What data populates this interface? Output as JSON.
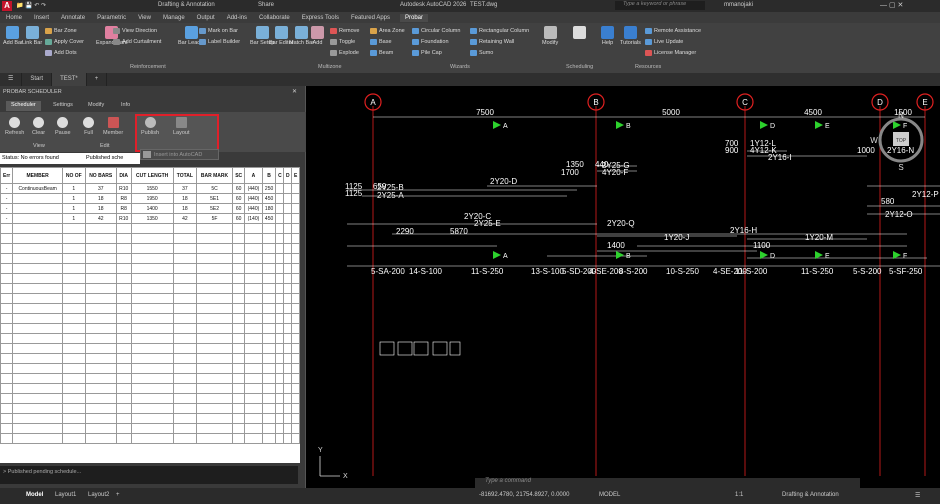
{
  "title": {
    "workspace": "Drafting & Annotation",
    "share": "Share",
    "app": "Autodesk AutoCAD 2026",
    "file": "TEST.dwg",
    "search_placeholder": "Type a keyword or phrase",
    "user": "mmanojaki"
  },
  "menu_tabs": [
    "Home",
    "Insert",
    "Annotate",
    "Parametric",
    "View",
    "Manage",
    "Output",
    "Add-ins",
    "Collaborate",
    "Express Tools",
    "Featured Apps",
    "Probar"
  ],
  "ribbon": {
    "add_bar": "Add\nBar",
    "link_bar": "Link\nBar",
    "bar_zone": "Bar Zone",
    "apply_cover": "Apply Cover",
    "add_dots": "Add Dots",
    "expand_bars": "Expand\nBars",
    "view_direction": "View Direction",
    "add_curtailment": "Add Curtailment",
    "bar_leader": "Bar\nLeader",
    "mark_on_bar": "Mark on Bar",
    "label_builder": "Label Builder",
    "bar_setup": "Bar\nSetup",
    "bar_editor": "Bar\nEditor",
    "match_bar": "Match\nBar",
    "add": "Add",
    "remove": "Remove",
    "toggle": "Toggle",
    "explode": "Explode",
    "area_zone": "Area Zone",
    "base": "Base",
    "beam": "Beam",
    "circular_column": "Circular Column",
    "foundation": "Foundation",
    "pile_cap": "Pile Cap",
    "rectangular_column": "Rectangular Column",
    "retaining_wall": "Retaining Wall",
    "sumo": "Sumo",
    "modify": "Modify",
    "help": "Help",
    "tutorials": "Tutorials",
    "remote_assistance": "Remote Assistance",
    "live_update": "Live Update",
    "license_manager": "License Manager",
    "panels": {
      "reinforcement": "Reinforcement",
      "multizone": "Multizone",
      "wizards": "Wizards",
      "scheduling": "Scheduling",
      "resources": "Resources"
    }
  },
  "file_tabs": [
    "Start",
    "TEST*"
  ],
  "probar": {
    "title": "PROBAR SCHEDULER",
    "tabs": [
      "Scheduler",
      "Settings",
      "Modify",
      "Info"
    ],
    "tools": {
      "refresh": "Refresh",
      "clear": "Clear",
      "pause": "Pause",
      "full": "Full",
      "member": "Member",
      "publish": "Publish",
      "layout": "Layout",
      "insert_autocad": "Insert into AutoCAD"
    },
    "groups": {
      "view": "View",
      "edit": "Edit"
    },
    "status_label": "Status: No errors found",
    "published": "Published sche",
    "columns": [
      "Err",
      "MEMBER",
      "NO OF",
      "NO BARS",
      "DIA",
      "CUT LENGTH",
      "TOTAL",
      "BAR MARK",
      "SC",
      "A",
      "B",
      "C",
      "D",
      "E"
    ],
    "rows": [
      [
        "-",
        "ContinuousBeam",
        "1",
        "37",
        "R10",
        "1550",
        "37",
        "5C",
        "60",
        "(440)",
        "250",
        "",
        "",
        ""
      ],
      [
        "-",
        "",
        "1",
        "18",
        "R8",
        "1950",
        "18",
        "5E1",
        "60",
        "(440)",
        "450",
        "",
        "",
        ""
      ],
      [
        "-",
        "",
        "1",
        "18",
        "R8",
        "1400",
        "18",
        "5E2",
        "60",
        "(440)",
        "180",
        "",
        "",
        ""
      ],
      [
        "-",
        "",
        "1",
        "42",
        "R10",
        "1350",
        "42",
        "5F",
        "60",
        "(140)",
        "450",
        "",
        "",
        ""
      ]
    ],
    "footer_status": "> Published pending schedule..."
  },
  "drawing": {
    "grid_labels": [
      "A",
      "B",
      "C",
      "D",
      "E"
    ],
    "dims": [
      "7500",
      "5000",
      "4500",
      "1500"
    ],
    "bar_labels": [
      "2Y20-D",
      "2Y25-B",
      "2Y25-A",
      "2Y20-C",
      "2Y25-E",
      "2Y20-Q",
      "2Y25-G",
      "4Y20-F",
      "1Y12-L",
      "4Y12-K",
      "2Y16-I",
      "2Y16-N",
      "2Y16-H",
      "1Y20-J",
      "1Y20-M",
      "2Y12-O",
      "2Y12-P"
    ],
    "lens": [
      "1350",
      "1700",
      "1125",
      "1125",
      "650",
      "2290",
      "5870",
      "700",
      "900",
      "1000",
      "1400",
      "1100",
      "580",
      "440"
    ],
    "sections": [
      "5-SA-200",
      "14-S-100",
      "11-S-250",
      "13-S-100",
      "5-SD-200",
      "4-SE-200",
      "8-S-200",
      "10-S-250",
      "4-SE-200",
      "11-S-200",
      "11-S-250",
      "5-S-200",
      "5-SF-250"
    ],
    "markers": [
      "A",
      "B",
      "D",
      "E",
      "F"
    ],
    "compass": {
      "n": "N",
      "w": "W",
      "s": "S",
      "top": "TOP"
    }
  },
  "command_placeholder": "Type a command",
  "bottom": {
    "tabs": [
      "Model",
      "Layout1",
      "Layout2"
    ],
    "coords": "-81692.4780, 21754.8927, 0.0000",
    "mode": "MODEL",
    "scale": "1:1",
    "workspace": "Drafting & Annotation"
  }
}
